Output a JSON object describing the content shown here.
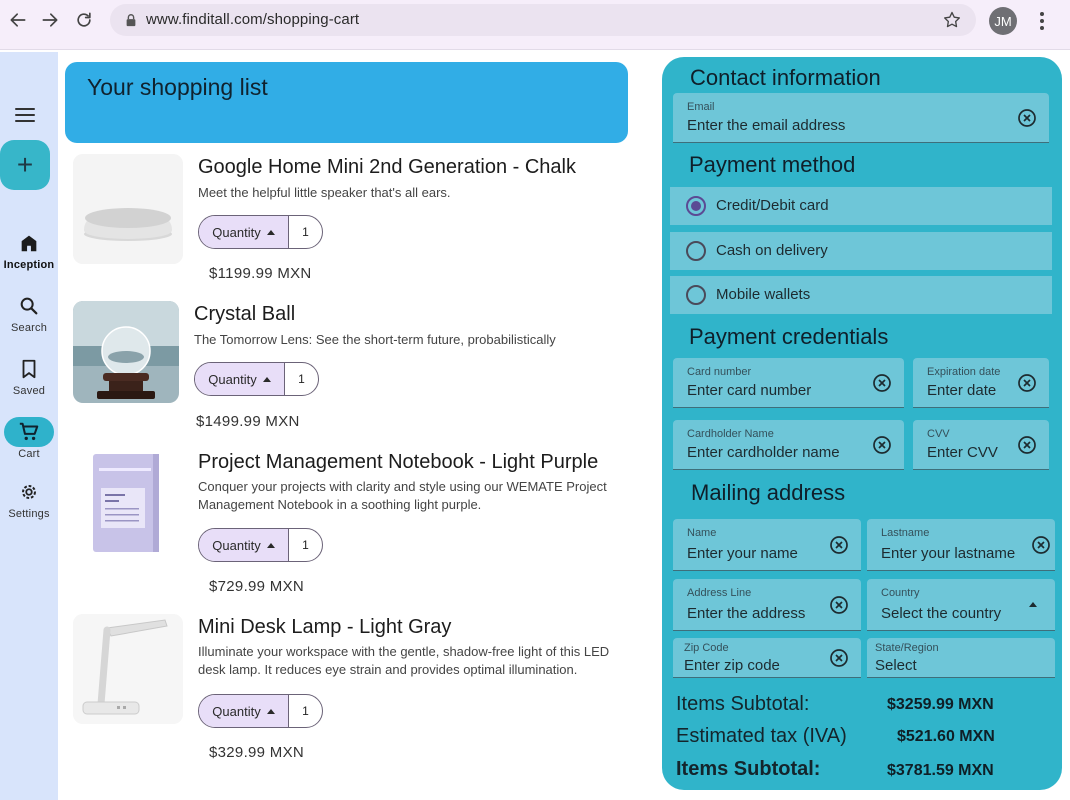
{
  "browser": {
    "url": "www.finditall.com/shopping-cart",
    "avatar_initials": "JM",
    "icons": [
      "arrow-back-icon",
      "arrow-forward-icon",
      "reload-icon",
      "lock-icon",
      "star-icon",
      "more-vert-icon"
    ]
  },
  "rail": {
    "items": [
      {
        "label": "Inception",
        "icon": "home-icon"
      },
      {
        "label": "Search",
        "icon": "search-icon"
      },
      {
        "label": "Saved",
        "icon": "bookmark-icon"
      },
      {
        "label": "Cart",
        "icon": "cart-icon"
      },
      {
        "label": "Settings",
        "icon": "gear-icon"
      }
    ],
    "fab_icon": "plus-icon",
    "menu_icon": "menu-icon"
  },
  "list": {
    "title": "Your shopping list",
    "quantity_label": "Quantity",
    "products": [
      {
        "name": "Google Home Mini 2nd Generation - Chalk",
        "description": "Meet the helpful little speaker that's all ears.",
        "quantity": "1",
        "price": "$1199.99 MXN"
      },
      {
        "name": "Crystal Ball",
        "description": "The Tomorrow Lens: See the short-term future, probabilistically",
        "quantity": "1",
        "price": "$1499.99 MXN"
      },
      {
        "name": "Project Management Notebook - Light Purple",
        "description": "Conquer your projects with clarity and style using our WEMATE Project Management Notebook in a soothing light purple.",
        "quantity": "1",
        "price": "$729.99 MXN"
      },
      {
        "name": "Mini Desk Lamp - Light Gray",
        "description": "Illuminate your workspace with the gentle, shadow-free light of this LED desk lamp. It reduces eye strain and provides optimal illumination.",
        "quantity": "1",
        "price": "$329.99 MXN"
      }
    ]
  },
  "checkout": {
    "contact_title": "Contact information",
    "email": {
      "label": "Email",
      "placeholder": "Enter the email address"
    },
    "payment_title": "Payment method",
    "payment_options": [
      {
        "label": "Credit/Debit card",
        "selected": true
      },
      {
        "label": "Cash on delivery",
        "selected": false
      },
      {
        "label": "Mobile wallets",
        "selected": false
      }
    ],
    "credentials_title": "Payment credentials",
    "card_number": {
      "label": "Card number",
      "placeholder": "Enter card number"
    },
    "expiration": {
      "label": "Expiration date",
      "placeholder": "Enter date"
    },
    "cardholder": {
      "label": "Cardholder Name",
      "placeholder": "Enter cardholder name"
    },
    "cvv": {
      "label": "CVV",
      "placeholder": "Enter CVV"
    },
    "mailing_title": "Mailing address",
    "name": {
      "label": "Name",
      "placeholder": "Enter your name"
    },
    "lastname": {
      "label": "Lastname",
      "placeholder": "Enter your lastname"
    },
    "address": {
      "label": "Address Line",
      "placeholder": "Enter the address"
    },
    "country": {
      "label": "Country",
      "placeholder": "Select the country"
    },
    "zip": {
      "label": "Zip Code",
      "placeholder": "Enter zip code"
    },
    "state": {
      "label": "State/Region",
      "placeholder": "Select"
    },
    "summary": {
      "subtotal_label": "Items Subtotal:",
      "subtotal_value": "$3259.99 MXN",
      "tax_label": "Estimated tax (IVA)",
      "tax_value": "$521.60 MXN",
      "total_label": "Items Subtotal:",
      "total_value": "$3781.59 MXN"
    }
  },
  "colors": {
    "header_blue": "#31ade6",
    "panel_teal": "#30b4ca",
    "field_teal": "#6ec6d8",
    "rail_bg": "#d8e4fb",
    "quantity_chip": "#e8def8"
  }
}
